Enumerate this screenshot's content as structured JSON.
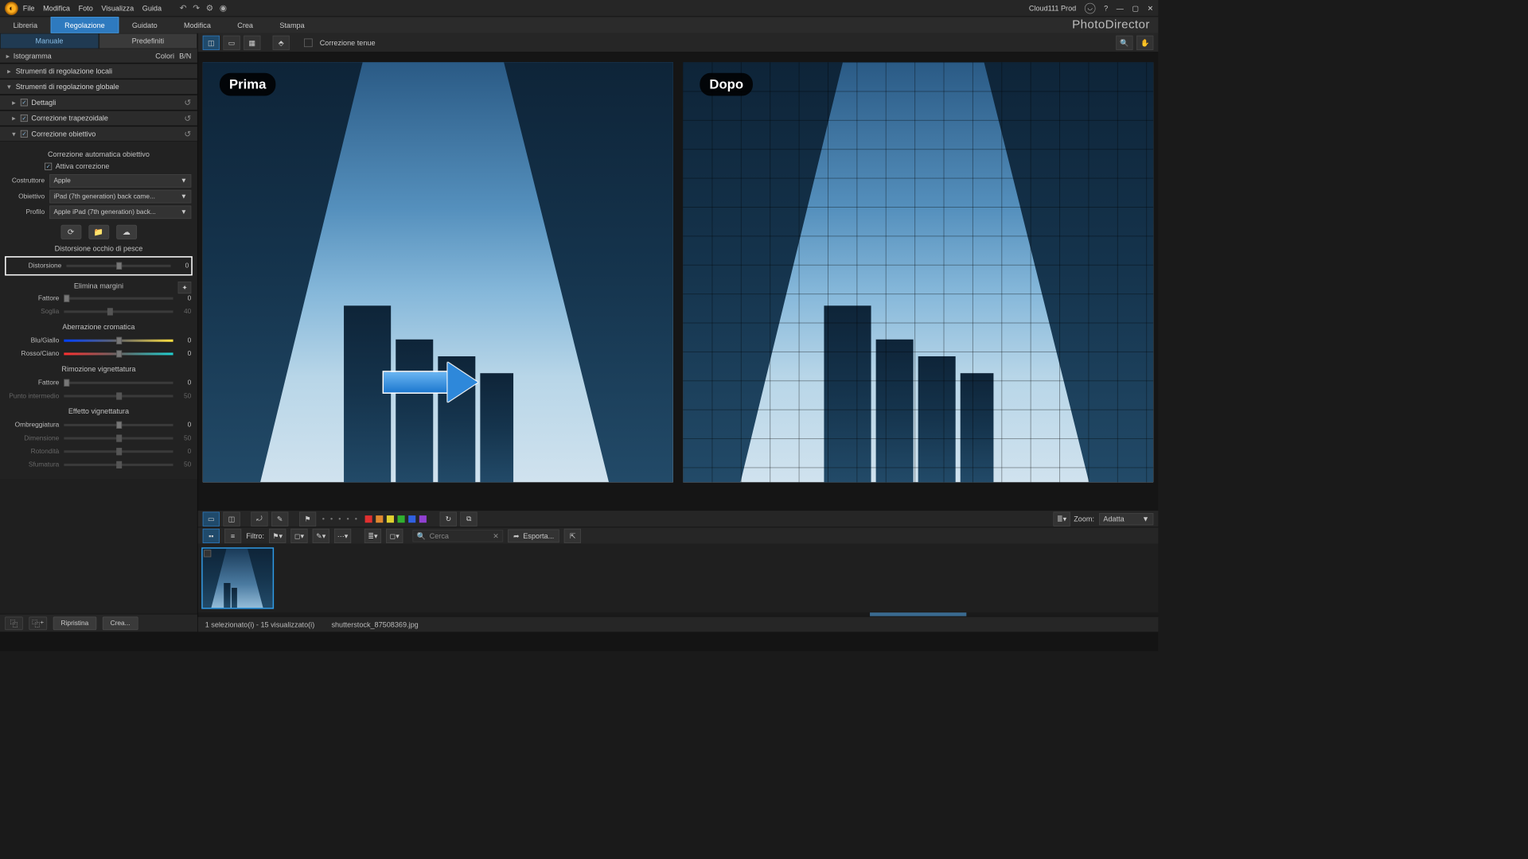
{
  "top": {
    "menus": [
      "File",
      "Modifica",
      "Foto",
      "Visualizza",
      "Guida"
    ],
    "user": "Cloud111 Prod"
  },
  "tabs": {
    "libreria": "Libreria",
    "regolazione": "Regolazione",
    "guidato": "Guidato",
    "modifica": "Modifica",
    "crea": "Crea",
    "stampa": "Stampa",
    "brand": "PhotoDirector"
  },
  "viewbar": {
    "soft_correction": "Correzione tenue"
  },
  "subtabs": {
    "manual": "Manuale",
    "presets": "Predefiniti"
  },
  "histogram": {
    "label": "Istogramma",
    "colors": "Colori",
    "bw": "B/N"
  },
  "sections": {
    "local": "Strumenti di regolazione locali",
    "global": "Strumenti di regolazione globale",
    "detail": "Dettagli",
    "trapezoid": "Correzione trapezoidale",
    "lens": "Correzione obiettivo"
  },
  "lens": {
    "auto": "Correzione automatica obiettivo",
    "enable": "Attiva correzione",
    "maker_label": "Costruttore",
    "maker": "Apple",
    "lens_label": "Obiettivo",
    "lens": "iPad (7th generation) back came...",
    "profile_label": "Profilo",
    "profile": "Apple iPad (7th generation) back...",
    "fisheye": "Distorsione occhio di pesce",
    "distortion_label": "Distorsione",
    "distortion_val": "0",
    "crop": "Elimina margini",
    "factor_label": "Fattore",
    "factor_val": "0",
    "threshold_label": "Soglia",
    "threshold_val": "40",
    "chroma": "Aberrazione cromatica",
    "by_label": "Blu/Giallo",
    "by_val": "0",
    "rc_label": "Rosso/Ciano",
    "rc_val": "0",
    "devig": "Rimozione vignettatura",
    "devig_factor_label": "Fattore",
    "devig_factor_val": "0",
    "mid_label": "Punto intermedio",
    "mid_val": "50",
    "vig": "Effetto vignettatura",
    "shade_label": "Ombreggiatura",
    "shade_val": "0",
    "size_label": "Dimensione",
    "size_val": "50",
    "round_label": "Rotondità",
    "round_val": "0",
    "feather_label": "Sfumatura",
    "feather_val": "50"
  },
  "sidebar_btm": {
    "reset": "Ripristina",
    "create": "Crea..."
  },
  "compare": {
    "before": "Prima",
    "after": "Dopo"
  },
  "fs": {
    "filter": "Filtro:",
    "zoom": "Zoom:",
    "fit": "Adatta",
    "search": "Cerca",
    "export": "Esporta..."
  },
  "status": {
    "sel": "1 selezionato(i) - 15 visualizzato(i)",
    "file": "shutterstock_87508369.jpg"
  }
}
